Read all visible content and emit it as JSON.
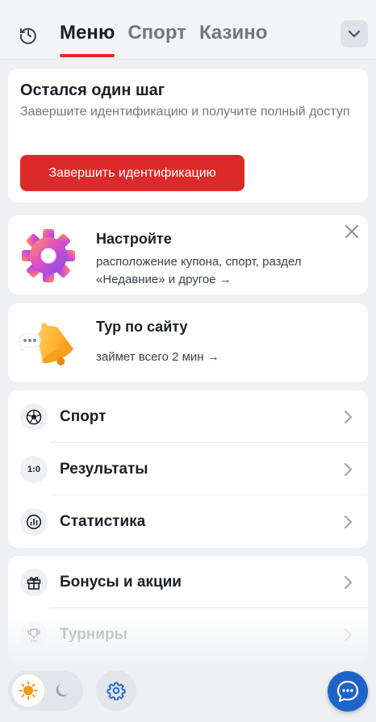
{
  "header": {
    "tabs": [
      {
        "label": "Меню",
        "active": true
      },
      {
        "label": "Спорт",
        "active": false
      },
      {
        "label": "Казино",
        "active": false
      }
    ]
  },
  "identification": {
    "title": "Остался один шаг",
    "subtitle": "Завершите идентификацию и получите полный доступ",
    "button_label": "Завершить идентификацию"
  },
  "promos": [
    {
      "title": "Настройте",
      "text": "расположение купона, спорт, раздел «Недавние» и другое →",
      "icon": "gear-icon"
    },
    {
      "title": "Тур по сайту",
      "text": "займет всего 2 мин →",
      "icon": "bell-icon"
    }
  ],
  "menu_groups": [
    {
      "items": [
        {
          "label": "Спорт",
          "icon": "soccer-ball-icon"
        },
        {
          "label": "Результаты",
          "icon": "score-icon",
          "icon_text": "1:0"
        },
        {
          "label": "Статистика",
          "icon": "statistics-icon"
        }
      ]
    },
    {
      "items": [
        {
          "label": "Бонусы и акции",
          "icon": "gift-icon"
        },
        {
          "label": "Турниры",
          "icon": "trophy-icon"
        }
      ]
    }
  ],
  "colors": {
    "accent": "#dc2a2a",
    "chat": "#1e63c8",
    "background": "#eef0f3"
  }
}
